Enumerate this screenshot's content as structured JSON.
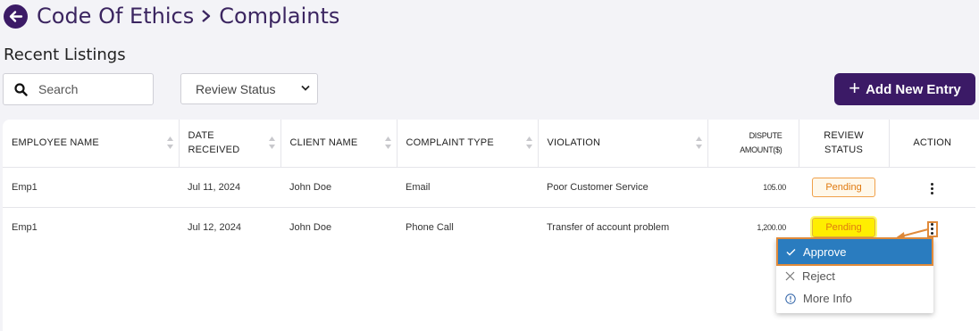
{
  "header": {
    "crumbs": [
      "Code Of Ethics",
      "Complaints"
    ]
  },
  "section_title": "Recent Listings",
  "search": {
    "placeholder": "Search"
  },
  "filter": {
    "selected": "Review Status"
  },
  "add_button": {
    "label": "Add New Entry"
  },
  "table": {
    "columns": [
      {
        "line1": "EMPLOYEE NAME",
        "line2": ""
      },
      {
        "line1": "DATE",
        "line2": "RECEIVED"
      },
      {
        "line1": "CLIENT NAME",
        "line2": ""
      },
      {
        "line1": "COMPLAINT TYPE",
        "line2": ""
      },
      {
        "line1": "VIOLATION",
        "line2": ""
      },
      {
        "line1": "DISPUTE",
        "line2": "AMOUNT($)"
      },
      {
        "line1": "REVIEW",
        "line2": "STATUS"
      },
      {
        "line1": "ACTION",
        "line2": ""
      }
    ],
    "rows": [
      {
        "employee": "Emp1",
        "date": "Jul 11, 2024",
        "client": "John Doe",
        "type": "Email",
        "violation": "Poor Customer Service",
        "amount": "105.00",
        "status": "Pending"
      },
      {
        "employee": "Emp1",
        "date": "Jul 12, 2024",
        "client": "John Doe",
        "type": "Phone Call",
        "violation": "Transfer of account problem",
        "amount": "1,200.00",
        "status": "Pending"
      }
    ]
  },
  "action_menu": {
    "items": [
      {
        "label": "Approve",
        "icon": "check-icon"
      },
      {
        "label": "Reject",
        "icon": "x-icon"
      },
      {
        "label": "More Info",
        "icon": "info-icon"
      }
    ]
  },
  "colors": {
    "brand": "#3b1a66",
    "selected_menu": "#2a7cbf",
    "highlight": "#ffee00",
    "annotation": "#e08a3a",
    "pending": "#e07a10"
  }
}
